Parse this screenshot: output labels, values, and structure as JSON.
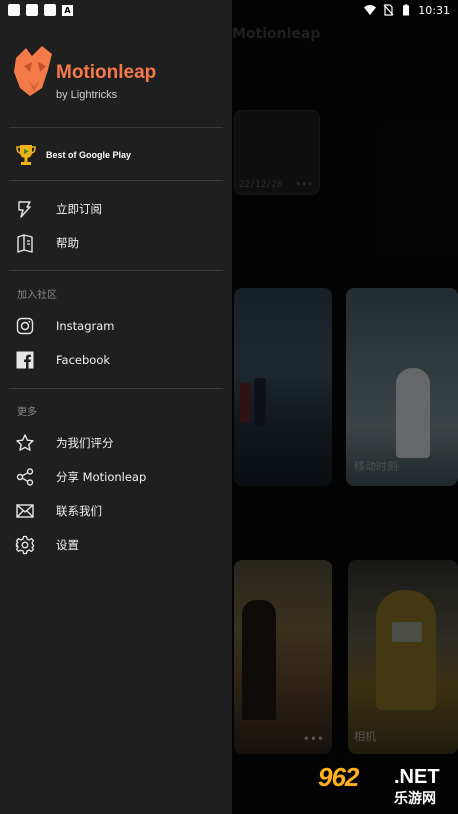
{
  "status_bar": {
    "time": "10:31",
    "left_icons": [
      "notification-square-icon",
      "notification-square-icon",
      "notification-square-icon",
      "notification-a-icon"
    ],
    "right_icons": [
      "wifi-icon",
      "no-sim-icon",
      "battery-icon"
    ],
    "a_glyph": "A"
  },
  "background": {
    "title": "Motionleap",
    "project_date": "22/12/20",
    "project_more": "•••",
    "card_move_label": "移动时刻",
    "card_more": "•••",
    "card_bottom_label": "相机"
  },
  "drawer": {
    "brand": {
      "name": "Motionleap",
      "byline": "by Lightricks",
      "accent_color": "#f47a4a"
    },
    "award": {
      "icon": "trophy-icon",
      "label": "Best of Google Play"
    },
    "top_items": [
      {
        "icon": "subscribe-icon",
        "label": "立即订阅"
      },
      {
        "icon": "help-book-icon",
        "label": "帮助"
      }
    ],
    "community": {
      "title": "加入社区",
      "items": [
        {
          "icon": "instagram-icon",
          "label": "Instagram"
        },
        {
          "icon": "facebook-icon",
          "label": "Facebook"
        }
      ]
    },
    "more": {
      "title": "更多",
      "items": [
        {
          "icon": "star-icon",
          "label": "为我们评分"
        },
        {
          "icon": "share-icon",
          "label": "分享 Motionleap"
        },
        {
          "icon": "mail-icon",
          "label": "联系我们"
        },
        {
          "icon": "gear-icon",
          "label": "设置"
        }
      ]
    }
  },
  "watermark": {
    "number": "962",
    "suffix": ".NET",
    "cn": "乐游网"
  }
}
